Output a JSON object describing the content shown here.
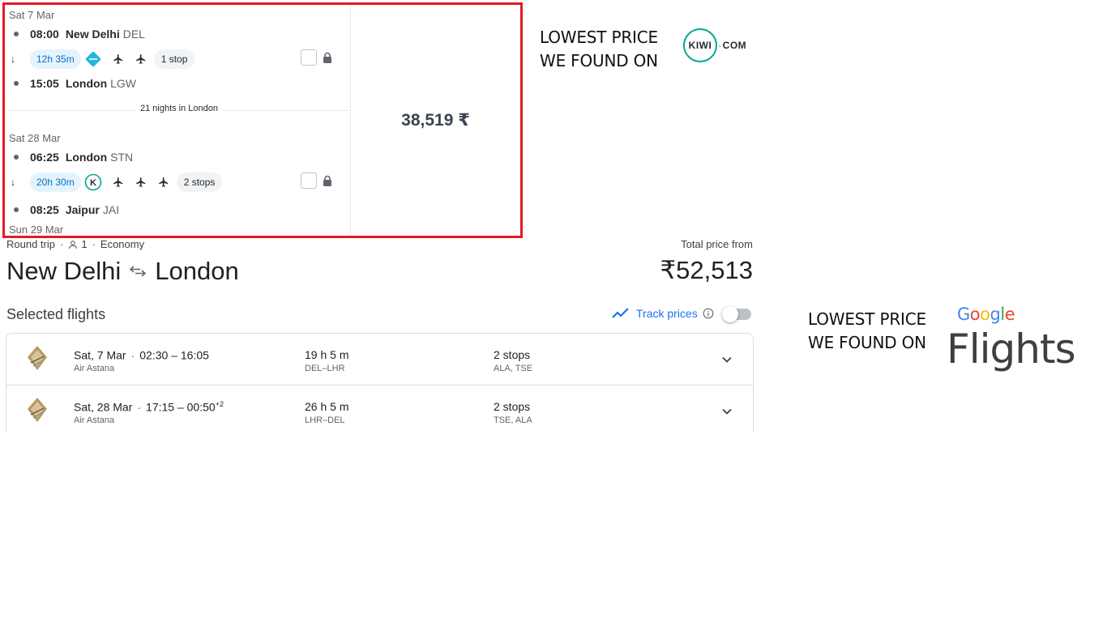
{
  "kiwi": {
    "outbound": {
      "date": "Sat 7 Mar",
      "depart_time": "08:00",
      "depart_city": "New Delhi",
      "depart_code": "DEL",
      "duration": "12h 35m",
      "stops": "1 stop",
      "arrive_time": "15:05",
      "arrive_city": "London",
      "arrive_code": "LGW"
    },
    "nights": "21 nights in London",
    "inbound": {
      "date": "Sat 28 Mar",
      "depart_time": "06:25",
      "depart_city": "London",
      "depart_code": "STN",
      "duration": "20h 30m",
      "stops": "2 stops",
      "arrive_time": "08:25",
      "arrive_city": "Jaipur",
      "arrive_code": "JAI",
      "arrive_date": "Sun 29 Mar"
    },
    "price": "38,519 ₹",
    "caption_line1": "LOWEST PRICE",
    "caption_line2": "WE FOUND ON",
    "logo_text": "KIWI",
    "logo_dot": "·",
    "logo_com": "COM",
    "accent": "#00a991"
  },
  "trip": {
    "type": "Round trip",
    "passengers": "1",
    "cabin": "Economy",
    "total_label": "Total price from",
    "origin": "New Delhi",
    "destination": "London",
    "total_price": "₹52,513"
  },
  "selected": {
    "label": "Selected flights",
    "track_label": "Track prices",
    "flights": [
      {
        "date": "Sat, 7 Mar",
        "times": "02:30 – 16:05",
        "times_sup": "",
        "airline": "Air Astana",
        "duration": "19 h 5 m",
        "route": "DEL–LHR",
        "stops": "2 stops",
        "stop_codes": "ALA, TSE"
      },
      {
        "date": "Sat, 28 Mar",
        "times": "17:15 – 00:50",
        "times_sup": "+2",
        "airline": "Air Astana",
        "duration": "26 h 5 m",
        "route": "LHR–DEL",
        "stops": "2 stops",
        "stop_codes": "TSE, ALA"
      }
    ]
  },
  "google_brand": {
    "caption_line1": "LOWEST PRICE",
    "caption_line2": "WE FOUND ON",
    "google_letters": [
      "G",
      "o",
      "o",
      "g",
      "l",
      "e"
    ],
    "google_colors": [
      "#4285f4",
      "#ea4335",
      "#fbbc05",
      "#4285f4",
      "#34a853",
      "#ea4335"
    ],
    "flights_word": "Flights"
  },
  "icons": {
    "plane": "plane-icon",
    "lock": "lock-icon",
    "arrow_down": "arrow-down-icon",
    "swap": "swap-arrows-icon",
    "person": "person-icon",
    "trend": "trend-icon",
    "info": "info-icon",
    "chevron": "chevron-down-icon"
  }
}
